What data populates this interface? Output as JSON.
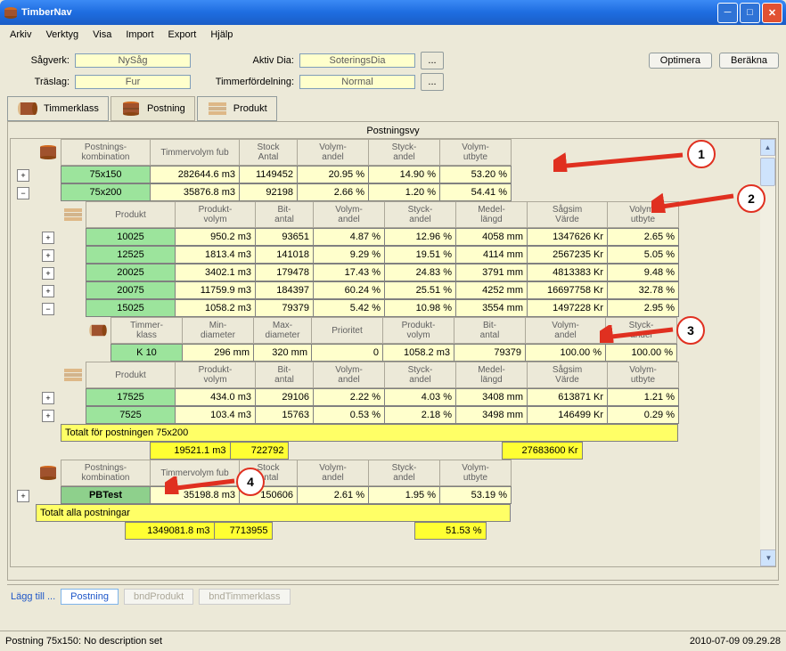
{
  "title": "TimberNav",
  "menu": [
    "Arkiv",
    "Verktyg",
    "Visa",
    "Import",
    "Export",
    "Hjälp"
  ],
  "fields": {
    "sagverk_label": "Sågverk:",
    "sagverk_val": "NySåg",
    "traslag_label": "Träslag:",
    "traslag_val": "Fur",
    "aktivdia_label": "Aktiv Dia:",
    "aktivdia_val": "SoteringsDia",
    "timmerf_label": "Timmerfördelning:",
    "timmerf_val": "Normal"
  },
  "buttons": {
    "optimera": "Optimera",
    "berakna": "Beräkna",
    "ellipsis": "..."
  },
  "tabs": {
    "timmerklass": "Timmerklass",
    "postning": "Postning",
    "produkt": "Produkt"
  },
  "panel_title": "Postningsvy",
  "callouts": [
    "1",
    "2",
    "3",
    "4"
  ],
  "hdr1": [
    "Postnings-\nkombination",
    "Timmervolym fub",
    "Stock\nAntal",
    "Volym-\nandel",
    "Styck-\nandel",
    "Volym-\nutbyte"
  ],
  "hdr2": [
    "Produkt",
    "Produkt-\nvolym",
    "Bit-\nantal",
    "Volym-\nandel",
    "Styck-\nandel",
    "Medel-\nlängd",
    "Sågsim\nVärde",
    "Volym-\nutbyte"
  ],
  "hdr3": [
    "Timmer-\nklass",
    "Min-\ndiameter",
    "Max-\ndiameter",
    "Prioritet",
    "Produkt-\nvolym",
    "Bit-\nantal",
    "Volym-\nandel",
    "Styck-\nandel"
  ],
  "postnings": [
    {
      "name": "75x150",
      "vol": "282644.6 m3",
      "stock": "1149452",
      "va": "20.95 %",
      "sa": "14.90 %",
      "vu": "53.20 %"
    },
    {
      "name": "75x200",
      "vol": "35876.8 m3",
      "stock": "92198",
      "va": "2.66 %",
      "sa": "1.20 %",
      "vu": "54.41 %"
    }
  ],
  "produkter1": [
    {
      "name": "10025",
      "pv": "950.2 m3",
      "ba": "93651",
      "va": "4.87 %",
      "sa": "12.96 %",
      "ml": "4058 mm",
      "sv": "1347626 Kr",
      "vu": "2.65 %"
    },
    {
      "name": "12525",
      "pv": "1813.4 m3",
      "ba": "141018",
      "va": "9.29 %",
      "sa": "19.51 %",
      "ml": "4114 mm",
      "sv": "2567235 Kr",
      "vu": "5.05 %"
    },
    {
      "name": "20025",
      "pv": "3402.1 m3",
      "ba": "179478",
      "va": "17.43 %",
      "sa": "24.83 %",
      "ml": "3791 mm",
      "sv": "4813383 Kr",
      "vu": "9.48 %"
    },
    {
      "name": "20075",
      "pv": "11759.9 m3",
      "ba": "184397",
      "va": "60.24 %",
      "sa": "25.51 %",
      "ml": "4252 mm",
      "sv": "16697758 Kr",
      "vu": "32.78 %"
    },
    {
      "name": "15025",
      "pv": "1058.2 m3",
      "ba": "79379",
      "va": "5.42 %",
      "sa": "10.98 %",
      "ml": "3554 mm",
      "sv": "1497228 Kr",
      "vu": "2.95 %"
    }
  ],
  "timmerklass": [
    {
      "name": "K 10",
      "min": "296 mm",
      "max": "320 mm",
      "prio": "0",
      "pv": "1058.2 m3",
      "ba": "79379",
      "va": "100.00 %",
      "sa": "100.00 %"
    }
  ],
  "produkter2": [
    {
      "name": "17525",
      "pv": "434.0 m3",
      "ba": "29106",
      "va": "2.22 %",
      "sa": "4.03 %",
      "ml": "3408 mm",
      "sv": "613871 Kr",
      "vu": "1.21 %"
    },
    {
      "name": "7525",
      "pv": "103.4 m3",
      "ba": "15763",
      "va": "0.53 %",
      "sa": "2.18 %",
      "ml": "3498 mm",
      "sv": "146499 Kr",
      "vu": "0.29 %"
    }
  ],
  "totals1": {
    "label": "Totalt för postningen 75x200",
    "vol": "19521.1 m3",
    "ba": "722792",
    "sv": "27683600 Kr"
  },
  "pbtest": {
    "name": "PBTest",
    "vol": "35198.8 m3",
    "stock": "150606",
    "va": "2.61 %",
    "sa": "1.95 %",
    "vu": "53.19 %"
  },
  "totals2": {
    "label": "Totalt alla postningar",
    "vol": "1349081.8 m3",
    "ba": "7713955",
    "vu": "51.53 %"
  },
  "bottom": {
    "laggtill": "Lägg till ...",
    "postning": "Postning",
    "bndprodukt": "bndProdukt",
    "bndtimmer": "bndTimmerklass"
  },
  "status": {
    "left": "Postning 75x150: No description set",
    "right": "2010-07-09 09.29.28"
  }
}
